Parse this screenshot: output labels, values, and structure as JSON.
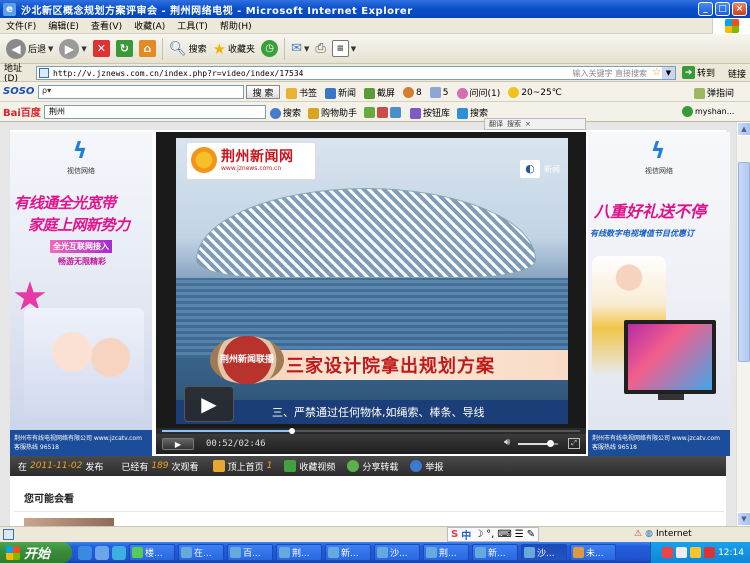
{
  "window": {
    "title": "沙北新区概念规划方案评审会 - 荆州网络电视 - Microsoft Internet Explorer",
    "controls": {
      "minimize": "_",
      "maximize": "□",
      "close": "×"
    }
  },
  "menu": {
    "items": [
      "文件(F)",
      "编辑(E)",
      "查看(V)",
      "收藏(A)",
      "工具(T)",
      "帮助(H)"
    ]
  },
  "toolbar": {
    "back": "后退",
    "search": "搜索",
    "favorites": "收藏夹"
  },
  "address": {
    "label": "地址(D)",
    "url": "http://v.jznews.com.cn/index.php?r=video/index/17534",
    "hint": "输入关键字 直接搜索",
    "go": "转到",
    "links": "链接"
  },
  "soso": {
    "logo": "SOSO",
    "search_button": "搜 索",
    "items": [
      "书签",
      "新闻",
      "截屏",
      "8",
      "5",
      "问问(1)",
      "20~25℃"
    ],
    "right_item": "弹指间"
  },
  "baidu": {
    "logo": "Bai百度",
    "query": "荆州",
    "items": [
      "搜索",
      "购物助手",
      "按钮库",
      "搜索"
    ],
    "account": "myshan..."
  },
  "float_widget": {
    "items": [
      "翻译",
      "搜索"
    ]
  },
  "left_banner": {
    "brand": "视信网络",
    "slogan_line1": "有线通全光宽带",
    "slogan_line2": "家庭上网新势力",
    "tag1": "全光互联网接入",
    "tag2": "畅游无限精彩",
    "footer": "荆州市有线电视网络有限公司  www.jzcatv.com  客服热线 96518"
  },
  "right_banner": {
    "brand": "视信网络",
    "slogan_line1": "八重好礼送不停",
    "slogan_line2": "有线数字电视增值节目优惠订",
    "footer": "荆州市有线电视网络有限公司  www.jzcatv.com  客服热线 96518"
  },
  "player": {
    "site_logo": "荆州新闻网",
    "site_url": "www.jznews.com.cn",
    "channel_text": "新闻",
    "program_badge": "荆州新闻联播",
    "headline": "三家设计院拿出规划方案",
    "ticker": "三、严禁通过任何物体,如绳索、棒条、导线",
    "time": "00:52/02:46",
    "progress": 0.31,
    "volume": 0.8
  },
  "info": {
    "published_prefix": "在",
    "published_date": "2011-11-02",
    "published_suffix": "发布",
    "views_prefix": "已经有",
    "views": "189",
    "views_suffix": "次观看",
    "top_label": "顶上首页",
    "top_count": "1",
    "fav_label": "收藏视频",
    "share_label": "分享转载",
    "report_label": "举报"
  },
  "section": {
    "may_like": "您可能会看"
  },
  "status": {
    "zone": "Internet"
  },
  "taskbar": {
    "start": "开始",
    "tasks": [
      "楼...",
      "在...",
      "百...",
      "荆...",
      "新...",
      "沙...",
      "荆...",
      "新...",
      "沙...",
      "未..."
    ],
    "clock": "12:14"
  },
  "colors": {
    "title_blue": "#0a4fc9",
    "headline_red": "#c1191a",
    "banner_pink": "#e3138d",
    "taskbar_blue": "#245edb",
    "start_green": "#3a8e3a"
  }
}
